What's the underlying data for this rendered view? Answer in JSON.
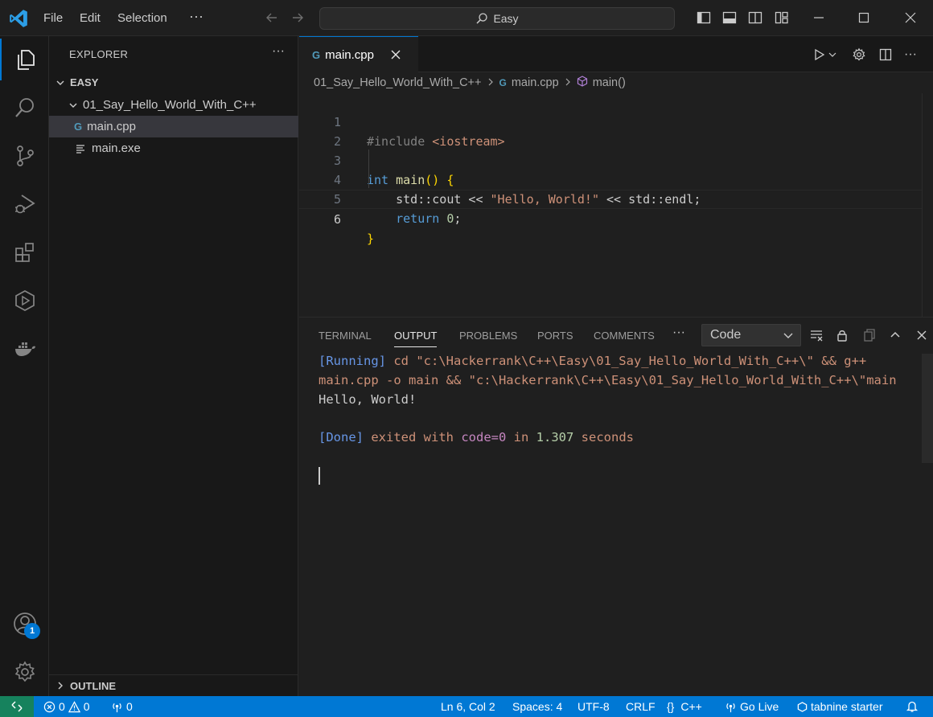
{
  "titlebar": {
    "menu": [
      "File",
      "Edit",
      "Selection"
    ],
    "more": "···",
    "search_text": "Easy"
  },
  "activity": {
    "accounts_badge": "1"
  },
  "sidebar": {
    "title": "EXPLORER",
    "more": "···",
    "root": "EASY",
    "folder": "01_Say_Hello_World_With_C++",
    "files": [
      "main.cpp",
      "main.exe"
    ],
    "outline": "OUTLINE"
  },
  "editor": {
    "tab_label": "main.cpp",
    "breadcrumb": {
      "folder": "01_Say_Hello_World_With_C++",
      "file": "main.cpp",
      "symbol": "main()"
    },
    "line_numbers": [
      "1",
      "2",
      "3",
      "4",
      "5",
      "6"
    ],
    "code": {
      "l1_directive": "#include",
      "l1_header": "<iostream>",
      "l3_type": "int",
      "l3_fn": "main",
      "l3_parens": "()",
      "l3_brace": "{",
      "l4_indent": "    ",
      "l4_cout": "std::cout",
      "l4_op1": " << ",
      "l4_str": "\"Hello, World!\"",
      "l4_op2": " << ",
      "l4_endl": "std::endl;",
      "l5_indent": "    ",
      "l5_return": "return",
      "l5_num": "0",
      "l5_semi": ";",
      "l6_brace": "}"
    }
  },
  "panel": {
    "tabs": [
      "TERMINAL",
      "OUTPUT",
      "PROBLEMS",
      "PORTS",
      "COMMENTS"
    ],
    "more": "···",
    "dropdown_value": "Code",
    "output": {
      "running_tag": "[Running]",
      "cmd_line1": " cd \"c:\\Hackerrank\\C++\\Easy\\01_Say_Hello_World_With_C++\\\" && g++",
      "cmd_line2": "main.cpp -o main && \"c:\\Hackerrank\\C++\\Easy\\01_Say_Hello_World_With_C++\\\"main",
      "program_output": "Hello, World!",
      "done_tag": "[Done]",
      "exited_text": " exited with ",
      "code_text": "code=0",
      "in_text": " in ",
      "time_value": "1.307",
      "seconds_text": " seconds"
    }
  },
  "statusbar": {
    "errors": "0",
    "warnings": "0",
    "ports": "0",
    "position": "Ln 6, Col 2",
    "spaces": "Spaces: 4",
    "encoding": "UTF-8",
    "eol": "CRLF",
    "language_braces": "{}",
    "language": "C++",
    "golive": "Go Live",
    "tabnine": "tabnine starter"
  },
  "colors": {
    "accent": "#0078d4",
    "remote": "#16825d",
    "background": "#1f1f1f"
  },
  "icons": [
    "vscode-logo-icon",
    "back-arrow-icon",
    "forward-arrow-icon",
    "search-icon",
    "toggle-sidebar-icon",
    "toggle-panel-icon",
    "toggle-secondary-sidebar-icon",
    "customize-layout-icon",
    "minimize-icon",
    "maximize-icon",
    "close-icon",
    "explorer-icon",
    "search-view-icon",
    "source-control-icon",
    "run-debug-icon",
    "extensions-icon",
    "remote-explorer-icon",
    "docker-icon",
    "accounts-icon",
    "settings-gear-icon",
    "cpp-file-icon",
    "file-icon",
    "run-icon",
    "split-editor-icon",
    "clear-output-icon",
    "lock-icon",
    "copy-icon",
    "chevron-up-icon",
    "remote-icon",
    "error-icon",
    "warning-icon",
    "broadcast-icon",
    "bell-icon"
  ]
}
